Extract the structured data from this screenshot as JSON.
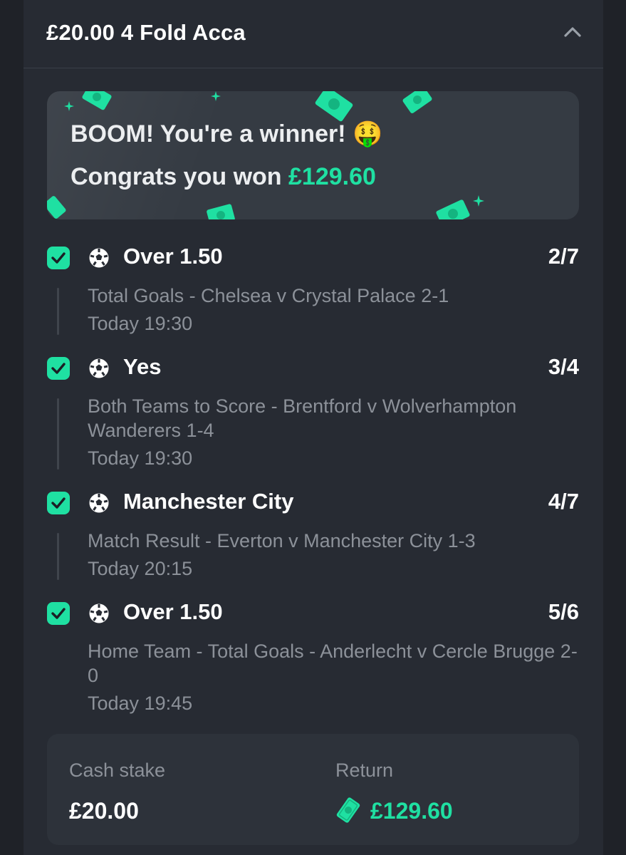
{
  "bet": {
    "title": "£20.00 4 Fold Acca"
  },
  "banner": {
    "headline": "BOOM! You're a winner! 🤑",
    "congrats_prefix": "Congrats you won ",
    "won_amount": "£129.60",
    "emoji_icon": "money-mouth-face"
  },
  "selections": [
    {
      "name": "Over 1.50",
      "odds": "2/7",
      "description": "Total Goals - Chelsea v Crystal Palace 2-1",
      "time": "Today 19:30",
      "status": "won",
      "sport_icon": "football-icon"
    },
    {
      "name": "Yes",
      "odds": "3/4",
      "description": "Both Teams to Score - Brentford v Wolverhampton Wanderers 1-4",
      "time": "Today 19:30",
      "status": "won",
      "sport_icon": "football-icon"
    },
    {
      "name": "Manchester City",
      "odds": "4/7",
      "description": "Match Result - Everton v Manchester City 1-3",
      "time": "Today 20:15",
      "status": "won",
      "sport_icon": "football-icon"
    },
    {
      "name": "Over 1.50",
      "odds": "5/6",
      "description": "Home Team - Total Goals - Anderlecht v Cercle Brugge 2-0",
      "time": "Today 19:45",
      "status": "won",
      "sport_icon": "football-icon"
    }
  ],
  "summary": {
    "stake_label": "Cash stake",
    "stake_value": "£20.00",
    "return_label": "Return",
    "return_value": "£129.60"
  },
  "colors": {
    "accent": "#1fe0a2",
    "background": "#1f2228",
    "card": "#272b33",
    "muted_text": "#8c9199"
  }
}
